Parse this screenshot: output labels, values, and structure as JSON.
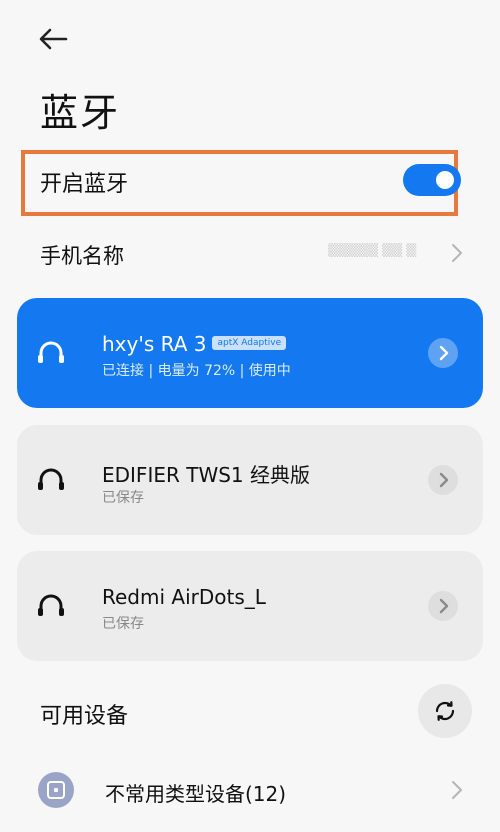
{
  "header": {
    "title": "蓝牙"
  },
  "bluetooth_toggle": {
    "label": "开启蓝牙",
    "enabled": true,
    "highlight_color": "#e7793e",
    "accent_color": "#1478f0"
  },
  "phone_name": {
    "label": "手机名称",
    "value": "▒▒▒▒▒ ▒▒ ▒"
  },
  "devices": [
    {
      "name": "hxy's RA 3",
      "badge": "aptX Adaptive",
      "status": "已连接 | 电量为 72% | 使用中",
      "connected": true,
      "icon": "headphones-icon"
    },
    {
      "name": "EDIFIER TWS1 经典版",
      "status": "已保存",
      "connected": false,
      "icon": "headphones-icon"
    },
    {
      "name": "Redmi AirDots_L",
      "status": "已保存",
      "connected": false,
      "icon": "headphones-icon"
    }
  ],
  "available": {
    "label": "可用设备",
    "refresh_icon": "refresh-icon",
    "uncommon": {
      "label": "不常用类型设备(12)",
      "icon": "device-icon"
    }
  }
}
